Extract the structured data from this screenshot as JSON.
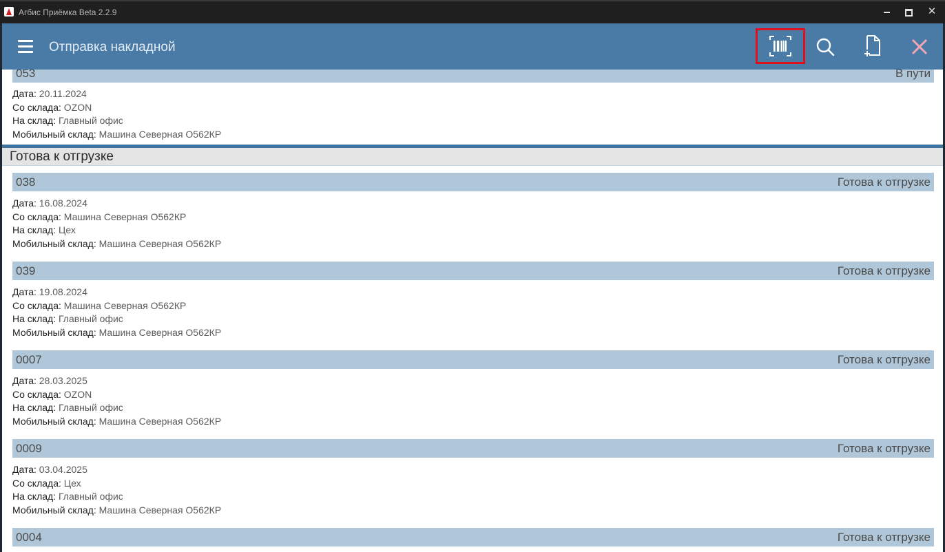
{
  "window": {
    "title": "Агбис Приёмка Beta 2.2.9",
    "controls": [
      "minimize-icon",
      "maximize-icon",
      "close-icon"
    ]
  },
  "toolbar": {
    "title": "Отправка накладной",
    "icons": [
      "hamburger-menu-icon",
      "barcode-scan-icon",
      "search-icon",
      "new-document-icon",
      "close-icon"
    ]
  },
  "labels": {
    "date": "Дата:",
    "from": "Со склада:",
    "to": "На склад:",
    "mobile": "Мобильный склад:"
  },
  "partial_item": {
    "number": "053",
    "status": "В пути",
    "date": "20.11.2024",
    "from": "OZON",
    "to": "Главный офис",
    "mobile": "Машина Северная О562КР"
  },
  "section": {
    "title": "Готова к отгрузке"
  },
  "items": [
    {
      "number": "038",
      "status": "Готова к отгрузке",
      "date": "16.08.2024",
      "from": "Машина Северная О562КР",
      "to": "Цех",
      "mobile": "Машина Северная О562КР"
    },
    {
      "number": "039",
      "status": "Готова к отгрузке",
      "date": "19.08.2024",
      "from": "Машина Северная О562КР",
      "to": "Главный офис",
      "mobile": "Машина Северная О562КР"
    },
    {
      "number": "0007",
      "status": "Готова к отгрузке",
      "date": "28.03.2025",
      "from": "OZON",
      "to": "Главный офис",
      "mobile": "Машина Северная О562КР"
    },
    {
      "number": "0009",
      "status": "Готова к отгрузке",
      "date": "03.04.2025",
      "from": "Цех",
      "to": "Главный офис",
      "mobile": "Машина Северная О562КР"
    },
    {
      "number": "0004",
      "status": "Готова к отгрузке"
    }
  ],
  "colors": {
    "toolbar": "#4a7aa6",
    "item_header": "#afc7d8",
    "section_rule": "#3f73a0",
    "highlight": "#e0101a"
  }
}
